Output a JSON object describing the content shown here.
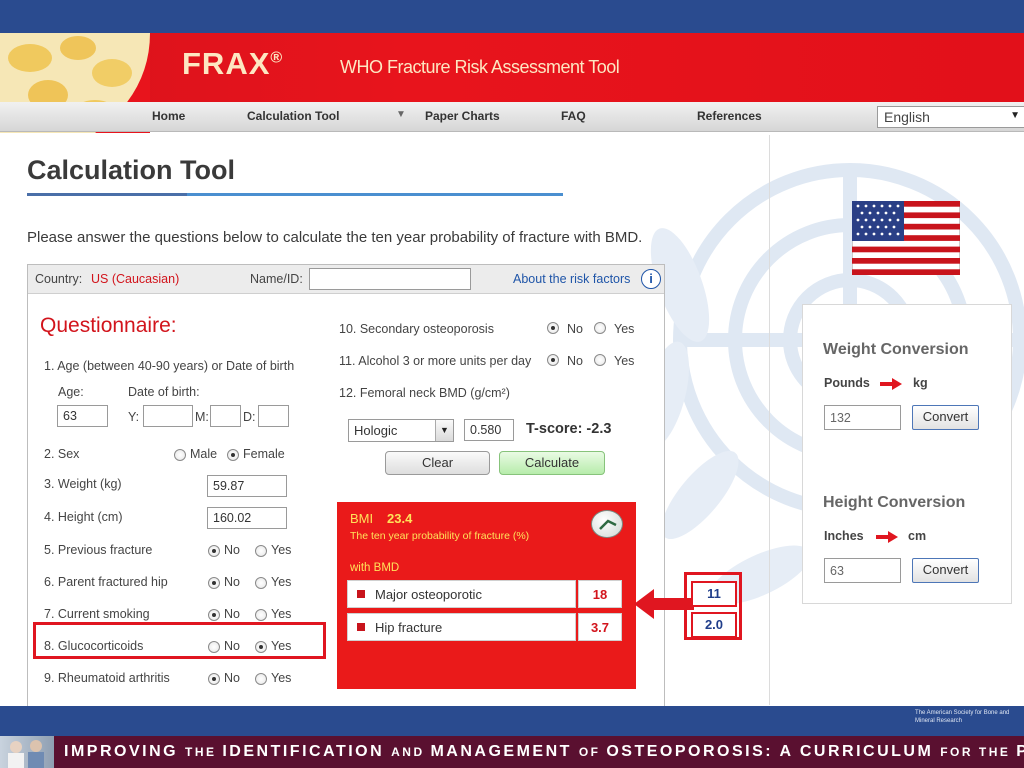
{
  "header": {
    "logo": "FRAX",
    "logo_mark": "®",
    "subtitle": "WHO Fracture Risk Assessment Tool"
  },
  "nav": {
    "items": [
      "Home",
      "Calculation Tool",
      "Paper Charts",
      "FAQ",
      "References"
    ],
    "dropdown_arrow": "▼",
    "language": "English"
  },
  "page": {
    "title": "Calculation Tool",
    "instructions": "Please answer the questions below to calculate the ten year probability of fracture with BMD."
  },
  "form": {
    "country_label": "Country:",
    "country_value": "US (Caucasian)",
    "name_label": "Name/ID:",
    "name_value": "",
    "about_link": "About the risk factors",
    "info_glyph": "i",
    "questionnaire_title": "Questionnaire:",
    "q1": "1. Age (between 40-90 years) or Date of birth",
    "age_label": "Age:",
    "age_value": "63",
    "dob_label": "Date of birth:",
    "y_label": "Y:",
    "m_label": "M:",
    "d_label": "D:",
    "q2": "2. Sex",
    "male": "Male",
    "female": "Female",
    "q3": "3. Weight (kg)",
    "weight_value": "59.87",
    "q4": "4. Height (cm)",
    "height_value": "160.02",
    "q5": "5. Previous fracture",
    "q6": "6. Parent fractured hip",
    "q7": "7. Current smoking",
    "q8": "8. Glucocorticoids",
    "q9": "9. Rheumatoid arthritis",
    "q10": "10. Secondary osteoporosis",
    "q11": "11. Alcohol 3 or more units per day",
    "q12": "12. Femoral neck BMD (g/cm²)",
    "no": "No",
    "yes": "Yes",
    "bmd_type": "Hologic",
    "bmd_value": "0.580",
    "tscore": "T-score: -2.3",
    "clear_button": "Clear",
    "calculate_button": "Calculate"
  },
  "results": {
    "bmi_label": "BMI",
    "bmi_value": "23.4",
    "probability_label": "The ten year probability of fracture (%)",
    "with_bmd": "with BMD",
    "major_label": "Major osteoporotic",
    "major_value": "18",
    "hip_label": "Hip fracture",
    "hip_value": "3.7"
  },
  "comparison": {
    "major_value": "11",
    "hip_value": "2.0"
  },
  "conversion": {
    "weight_title": "Weight Conversion",
    "pounds_label": "Pounds",
    "kg_label": "kg",
    "pounds_value": "132",
    "convert_label": "Convert",
    "height_title": "Height Conversion",
    "inches_label": "Inches",
    "cm_label": "cm",
    "inches_value": "63"
  },
  "footer": {
    "society": "The American Society for Bone and Mineral Research",
    "banner_parts": [
      {
        "text": "IMPROVING ",
        "small": false
      },
      {
        "text": "THE ",
        "small": true
      },
      {
        "text": "IDENTIFICATION ",
        "small": false
      },
      {
        "text": "AND ",
        "small": true
      },
      {
        "text": "MANAGEMENT ",
        "small": false
      },
      {
        "text": "OF ",
        "small": true
      },
      {
        "text": "OSTEOPOROSIS: A CURRICULUM ",
        "small": false
      },
      {
        "text": "FOR THE ",
        "small": true
      },
      {
        "text": "PCP",
        "small": false
      }
    ]
  },
  "colors": {
    "frax_red": "#e8141c",
    "nav_blue": "#2a4b8f",
    "footer_maroon": "#5a1030",
    "result_red": "#ea1a1a",
    "highlight_red": "#e01620"
  }
}
